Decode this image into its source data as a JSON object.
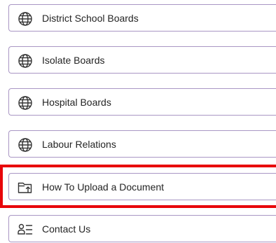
{
  "nav": {
    "items": [
      {
        "label": "District School Boards",
        "icon": "globe-icon"
      },
      {
        "label": "Isolate Boards",
        "icon": "globe-icon"
      },
      {
        "label": "Hospital Boards",
        "icon": "globe-icon"
      },
      {
        "label": "Labour Relations",
        "icon": "globe-icon"
      },
      {
        "label": "How To Upload a Document",
        "icon": "folder-upload-icon"
      },
      {
        "label": "Contact Us",
        "icon": "contact-list-icon"
      }
    ]
  },
  "colors": {
    "card_border": "#a996c4",
    "highlight": "#e8060a",
    "text": "#242424"
  }
}
